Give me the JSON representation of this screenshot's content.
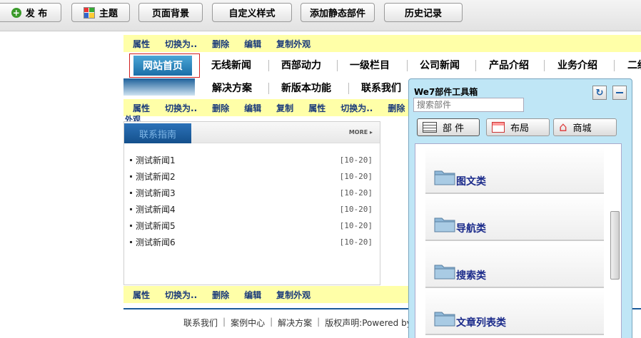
{
  "toolbar": {
    "publish": "发 布",
    "theme": "主题",
    "page_bg": "页面背景",
    "custom_style": "自定义样式",
    "add_static": "添加静态部件",
    "history": "历史记录"
  },
  "edit_bar": {
    "attr": "属性",
    "switch": "切换为..",
    "delete": "删除",
    "edit": "编辑",
    "copy_look": "复制外观",
    "copy": "复制",
    "look_partial": "外观"
  },
  "nav": {
    "home": "网站首页",
    "row1": [
      "无线新闻",
      "西部动力",
      "一级栏目",
      "公司新闻",
      "产品介绍",
      "业务介绍",
      "二级"
    ],
    "row2": [
      "解决方案",
      "新版本功能",
      "联系我们"
    ]
  },
  "news": {
    "tab": "联系指南",
    "more": "MORE ▸",
    "items": [
      {
        "title": "测试新闻1",
        "date": "[10-20]"
      },
      {
        "title": "测试新闻2",
        "date": "[10-20]"
      },
      {
        "title": "测试新闻3",
        "date": "[10-20]"
      },
      {
        "title": "测试新闻4",
        "date": "[10-20]"
      },
      {
        "title": "测试新闻5",
        "date": "[10-20]"
      },
      {
        "title": "测试新闻6",
        "date": "[10-20]"
      }
    ]
  },
  "footer": {
    "links": [
      "联系我们",
      "案例中心",
      "解决方案",
      "版权声明:Powered by"
    ]
  },
  "panel": {
    "title": "We7部件工具箱",
    "search_placeholder": "搜索部件",
    "tabs": {
      "widgets": "部 件",
      "layout": "布局",
      "store": "商城"
    },
    "categories": [
      "图文类",
      "导航类",
      "搜索类",
      "文章列表类"
    ]
  }
}
